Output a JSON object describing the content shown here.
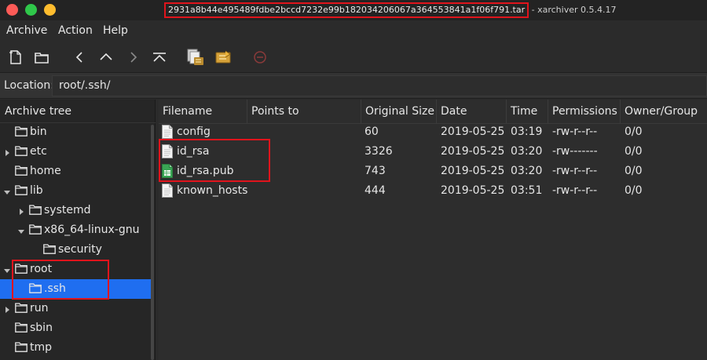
{
  "window": {
    "title_file": "2931a8b44e495489fdbe2bccd7232e99b182034206067a364553841a1f06f791.tar",
    "title_app": " - xarchiver 0.5.4.17"
  },
  "menu": [
    "Archive",
    "Action",
    "Help"
  ],
  "toolbar": {
    "icons": [
      "new-archive-icon",
      "open-archive-icon",
      "back-icon",
      "up-icon",
      "forward-icon",
      "home-icon",
      "extract-icon",
      "add-icon",
      "stop-icon"
    ]
  },
  "location": {
    "label": "Location:",
    "value": "root/.ssh/"
  },
  "tree": {
    "header": "Archive tree",
    "items": [
      {
        "label": "bin",
        "level": 0,
        "expander": "none",
        "selected": false
      },
      {
        "label": "etc",
        "level": 0,
        "expander": "collapsed",
        "selected": false
      },
      {
        "label": "home",
        "level": 0,
        "expander": "none",
        "selected": false
      },
      {
        "label": "lib",
        "level": 0,
        "expander": "expanded",
        "selected": false
      },
      {
        "label": "systemd",
        "level": 1,
        "expander": "collapsed",
        "selected": false
      },
      {
        "label": "x86_64-linux-gnu",
        "level": 1,
        "expander": "expanded",
        "selected": false
      },
      {
        "label": "security",
        "level": 2,
        "expander": "none",
        "selected": false
      },
      {
        "label": "root",
        "level": 0,
        "expander": "expanded",
        "selected": false
      },
      {
        "label": ".ssh",
        "level": 1,
        "expander": "none",
        "selected": true
      },
      {
        "label": "run",
        "level": 0,
        "expander": "collapsed",
        "selected": false
      },
      {
        "label": "sbin",
        "level": 0,
        "expander": "none",
        "selected": false
      },
      {
        "label": "tmp",
        "level": 0,
        "expander": "none",
        "selected": false
      }
    ]
  },
  "files": {
    "columns": [
      "Filename",
      "Points to",
      "Original Size",
      "Date",
      "Time",
      "Permissions",
      "Owner/Group"
    ],
    "rows": [
      {
        "name": "config",
        "points_to": "",
        "size": "60",
        "date": "2019-05-25",
        "time": "03:19",
        "perms": "-rw-r--r--",
        "owner": "0/0",
        "icon": "text-file-icon"
      },
      {
        "name": "id_rsa",
        "points_to": "",
        "size": "3326",
        "date": "2019-05-25",
        "time": "03:20",
        "perms": "-rw-------",
        "owner": "0/0",
        "icon": "text-file-icon"
      },
      {
        "name": "id_rsa.pub",
        "points_to": "",
        "size": "743",
        "date": "2019-05-25",
        "time": "03:20",
        "perms": "-rw-r--r--",
        "owner": "0/0",
        "icon": "spreadsheet-file-icon"
      },
      {
        "name": "known_hosts",
        "points_to": "",
        "size": "444",
        "date": "2019-05-25",
        "time": "03:51",
        "perms": "-rw-r--r--",
        "owner": "0/0",
        "icon": "text-file-icon"
      }
    ]
  },
  "colors": {
    "selection": "#1f6ef0",
    "highlight_box": "#e0141c"
  }
}
